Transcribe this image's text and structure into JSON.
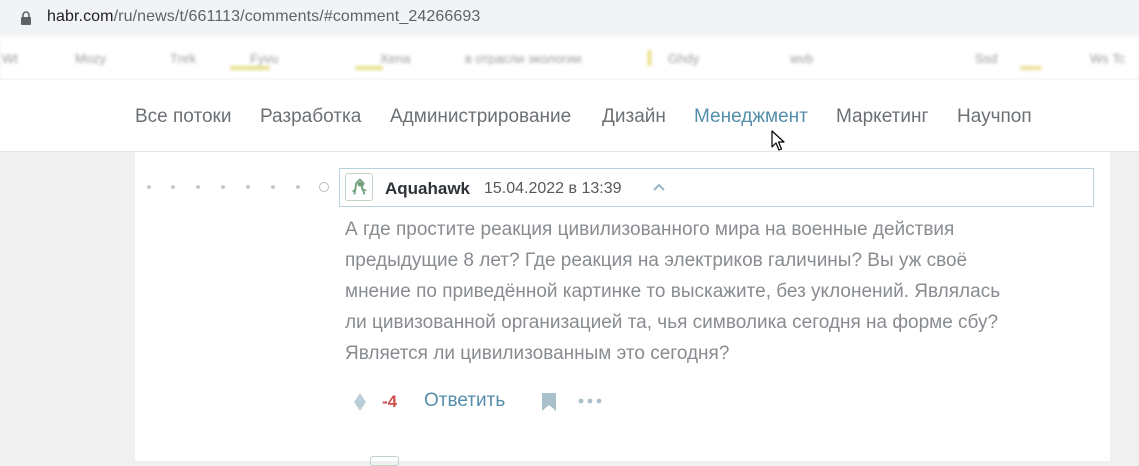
{
  "browser": {
    "url_host": "habr.com",
    "url_path": "/ru/news/t/661113/comments/#comment_24266693"
  },
  "bookmarks": [
    "Wt",
    "Mozy",
    "Tnrk",
    "Fyvu",
    "Xena",
    "в отрасли экологии",
    "Ghdy",
    "wvb",
    "Ssd",
    "Ws Tc"
  ],
  "nav": {
    "items": [
      "Все потоки",
      "Разработка",
      "Администрирование",
      "Дизайн",
      "Менеджмент",
      "Маркетинг",
      "Научпоп"
    ],
    "active": "Менеджмент"
  },
  "comment": {
    "author": "Aquahawk",
    "date": "15.04.2022 в 13:39",
    "lines": [
      "А где простите реакция цивилизованного мира на военные действия",
      "предыдущие 8 лет? Где реакция на электриков галичины? Вы уж своё",
      "мнение по приведённой картинке то выскажите, без уклонений. Являлась",
      "ли цивизованной организацией та, чья символика сегодня на форме сбу?",
      "Является ли цивилизованным это сегодня?"
    ],
    "score": "-4",
    "reply_label": "Ответить"
  },
  "colors": {
    "accent": "#548eaa",
    "negative_score": "#d04e4e",
    "text_muted": "#888c90"
  }
}
